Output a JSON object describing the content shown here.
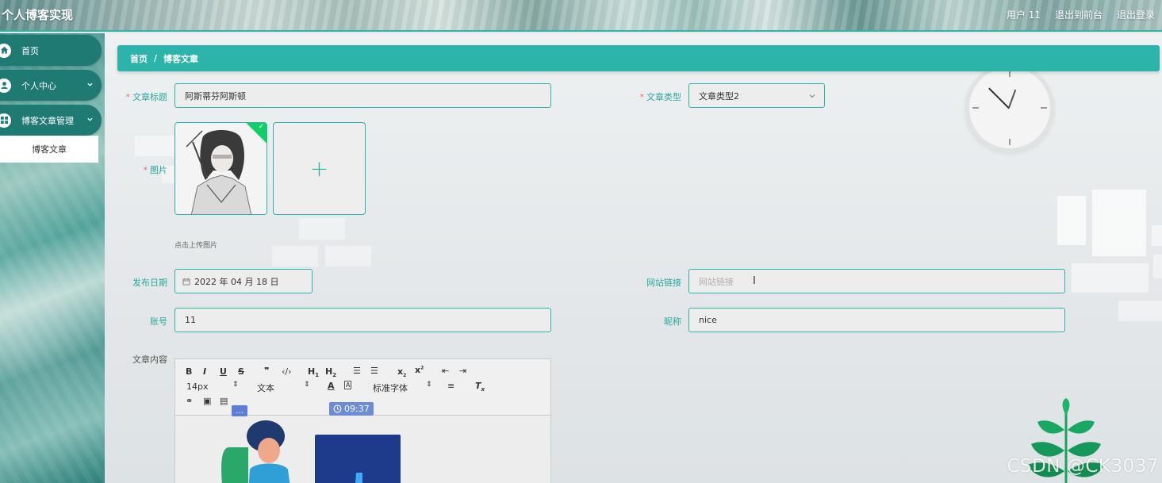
{
  "header": {
    "app_title": "个人博客实现",
    "user_label": "用户 11",
    "back_to_front": "退出到前台",
    "logout": "退出登录"
  },
  "sidebar": {
    "items": [
      {
        "label": "首页",
        "icon": "home-icon"
      },
      {
        "label": "个人中心",
        "icon": "user-icon"
      },
      {
        "label": "博客文章管理",
        "icon": "grid-icon"
      }
    ],
    "submenu": {
      "label": "博客文章"
    }
  },
  "breadcrumb": {
    "home": "首页",
    "separator": "/",
    "current": "博客文章"
  },
  "form": {
    "title_label": "文章标题",
    "title_value": "阿斯蒂芬阿斯顿",
    "type_label": "文章类型",
    "type_value": "文章类型2",
    "image_label": "图片",
    "upload_hint": "点击上传图片",
    "date_label": "发布日期",
    "date_value": "2022 年 04 月 18 日",
    "link_label": "网站链接",
    "link_placeholder": "网站链接",
    "account_label": "账号",
    "account_value": "11",
    "nickname_label": "昵称",
    "nickname_value": "nice",
    "content_label": "文章内容"
  },
  "editor": {
    "font_size": "14px",
    "text_style": "文本",
    "font_family": "标准字体",
    "time_badge": "09:37",
    "chat_badge": "..."
  },
  "watermark": "CSDN @CK3037",
  "colors": {
    "accent": "#2cb4aa",
    "sidebar_item": "#1e7a73",
    "required": "#f56c6c",
    "time_badge": "#6c8cd5"
  }
}
